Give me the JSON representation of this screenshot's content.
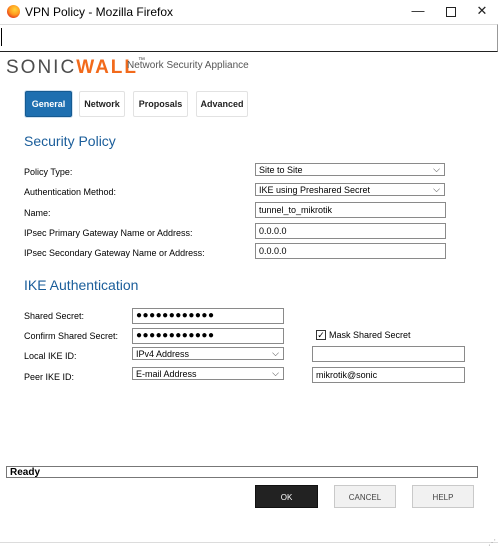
{
  "window": {
    "title": "VPN Policy - Mozilla Firefox",
    "minimize": "—",
    "close": "✕"
  },
  "brand": {
    "logo_sonic": "SONIC",
    "logo_wall": "WALL",
    "logo_tm": "™",
    "tagline": "Network Security Appliance"
  },
  "tabs": [
    {
      "label": "General",
      "active": true
    },
    {
      "label": "Network",
      "active": false
    },
    {
      "label": "Proposals",
      "active": false
    },
    {
      "label": "Advanced",
      "active": false
    }
  ],
  "security_policy": {
    "heading": "Security Policy",
    "policy_type_label": "Policy Type:",
    "policy_type_value": "Site to Site",
    "auth_method_label": "Authentication Method:",
    "auth_method_value": "IKE using Preshared Secret",
    "name_label": "Name:",
    "name_value": "tunnel_to_mikrotik",
    "primary_gw_label": "IPsec Primary Gateway Name or Address:",
    "primary_gw_value": "0.0.0.0",
    "secondary_gw_label": "IPsec Secondary Gateway Name or Address:",
    "secondary_gw_value": "0.0.0.0"
  },
  "ike_auth": {
    "heading": "IKE Authentication",
    "shared_secret_label": "Shared Secret:",
    "shared_secret_value": "●●●●●●●●●●●●",
    "confirm_secret_label": "Confirm Shared Secret:",
    "confirm_secret_value": "●●●●●●●●●●●●",
    "mask_label": "Mask Shared Secret",
    "mask_checked": true,
    "local_ike_label": "Local IKE ID:",
    "local_ike_type": "IPv4 Address",
    "local_ike_value": "",
    "peer_ike_label": "Peer IKE ID:",
    "peer_ike_type": "E-mail Address",
    "peer_ike_value": "mikrotik@sonic"
  },
  "status": "Ready",
  "buttons": {
    "ok": "OK",
    "cancel": "CANCEL",
    "help": "HELP"
  }
}
